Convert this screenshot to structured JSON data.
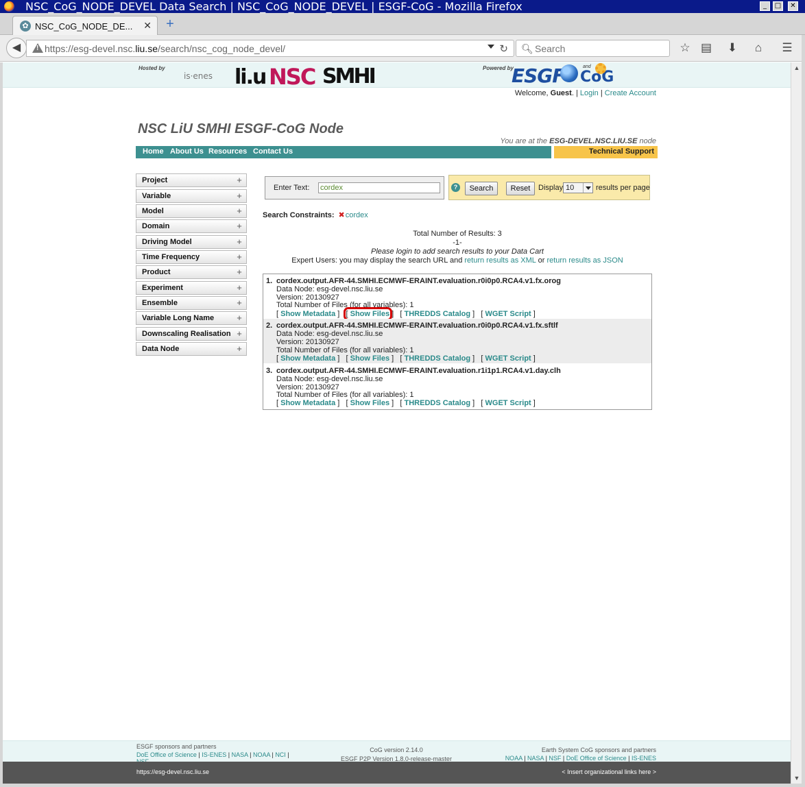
{
  "window": {
    "title": "NSC_CoG_NODE_DEVEL Data Search | NSC_CoG_NODE_DEVEL | ESGF-CoG - Mozilla Firefox",
    "minimize": "_",
    "maximize": "□",
    "close": "✕"
  },
  "tab": {
    "title": "NSC_CoG_NODE_DE...",
    "close": "✕",
    "new_tab": "+"
  },
  "browser": {
    "url_prefix": "https://esg-devel.nsc.",
    "url_domain": "liu.se",
    "url_suffix": "/search/nsc_cog_node_devel/",
    "search_placeholder": "Search"
  },
  "header": {
    "hosted_by": "Hosted by",
    "powered_by": "Powered by",
    "logos": {
      "isenes": "is·enes",
      "liu": "li.u",
      "nsc": "NSC",
      "smhi": "SMHI",
      "esgf": "ESGF",
      "and": "and",
      "cog": "CoG"
    }
  },
  "welcome": {
    "prefix": "Welcome, ",
    "user": "Guest",
    "suffix": ".  |",
    "login": "Login",
    "sep": "|",
    "create": "Create Account"
  },
  "site": {
    "title": "NSC LiU SMHI ESGF-CoG Node",
    "node_prefix": "You are at the ",
    "node_name": "ESG-DEVEL.NSC.LIU.SE",
    "node_suffix": " node"
  },
  "menu": [
    "Home",
    "About Us",
    "Resources",
    "Contact Us"
  ],
  "tech_support": "Technical Support",
  "facets": [
    "Project",
    "Variable",
    "Model",
    "Domain",
    "Driving Model",
    "Time Frequency",
    "Product",
    "Experiment",
    "Ensemble",
    "Variable Long Name",
    "Downscaling Realisation",
    "Data Node"
  ],
  "search": {
    "label": "Enter Text:",
    "value": "cordex",
    "help": "?",
    "search_button": "Search",
    "reset_button": "Reset",
    "display_label": "Display",
    "per_page": "10",
    "per_page_suffix": "results per page"
  },
  "constraints": {
    "label": "Search Constraints:",
    "value": "cordex"
  },
  "summary": {
    "total": "Total Number of Results: 3",
    "page": "-1-",
    "login_note": "Please login to add search results to your Data Cart",
    "expert_prefix": "Expert Users: you may display the search URL and ",
    "xml_link": "return results as XML",
    "or": " or ",
    "json_link": "return results as JSON"
  },
  "results": [
    {
      "num": "1.",
      "title": "cordex.output.AFR-44.SMHI.ECMWF-ERAINT.evaluation.r0i0p0.RCA4.v1.fx.orog",
      "data_node": "Data Node: esg-devel.nsc.liu.se",
      "version": "Version: 20130927",
      "files": "Total Number of Files (for all variables): 1"
    },
    {
      "num": "2.",
      "title": "cordex.output.AFR-44.SMHI.ECMWF-ERAINT.evaluation.r0i0p0.RCA4.v1.fx.sftlf",
      "data_node": "Data Node: esg-devel.nsc.liu.se",
      "version": "Version: 20130927",
      "files": "Total Number of Files (for all variables): 1"
    },
    {
      "num": "3.",
      "title": "cordex.output.AFR-44.SMHI.ECMWF-ERAINT.evaluation.r1i1p1.RCA4.v1.day.clh",
      "data_node": "Data Node: esg-devel.nsc.liu.se",
      "version": "Version: 20130927",
      "files": "Total Number of Files (for all variables): 1"
    }
  ],
  "result_links": {
    "metadata": "Show Metadata",
    "files": "Show Files",
    "thredds": "THREDDS Catalog",
    "wget": "WGET Script",
    "open": "[",
    "close": "]"
  },
  "footer": {
    "left_title": "ESGF sponsors and partners",
    "left_links": [
      "DoE Office of Science",
      "IS-ENES",
      "NASA",
      "NOAA",
      "NCI",
      "NSF"
    ],
    "cog_version": "CoG version 2.14.0",
    "p2p_version": "ESGF P2P Version 1.8.0-release-master",
    "right_title": "Earth System CoG sponsors and partners",
    "right_links": [
      "NOAA",
      "NASA",
      "NSF",
      "DoE Office of Science",
      "IS-ENES"
    ],
    "site_url": "https://esg-devel.nsc.liu.se",
    "org_links": "< Insert organizational links here >"
  }
}
